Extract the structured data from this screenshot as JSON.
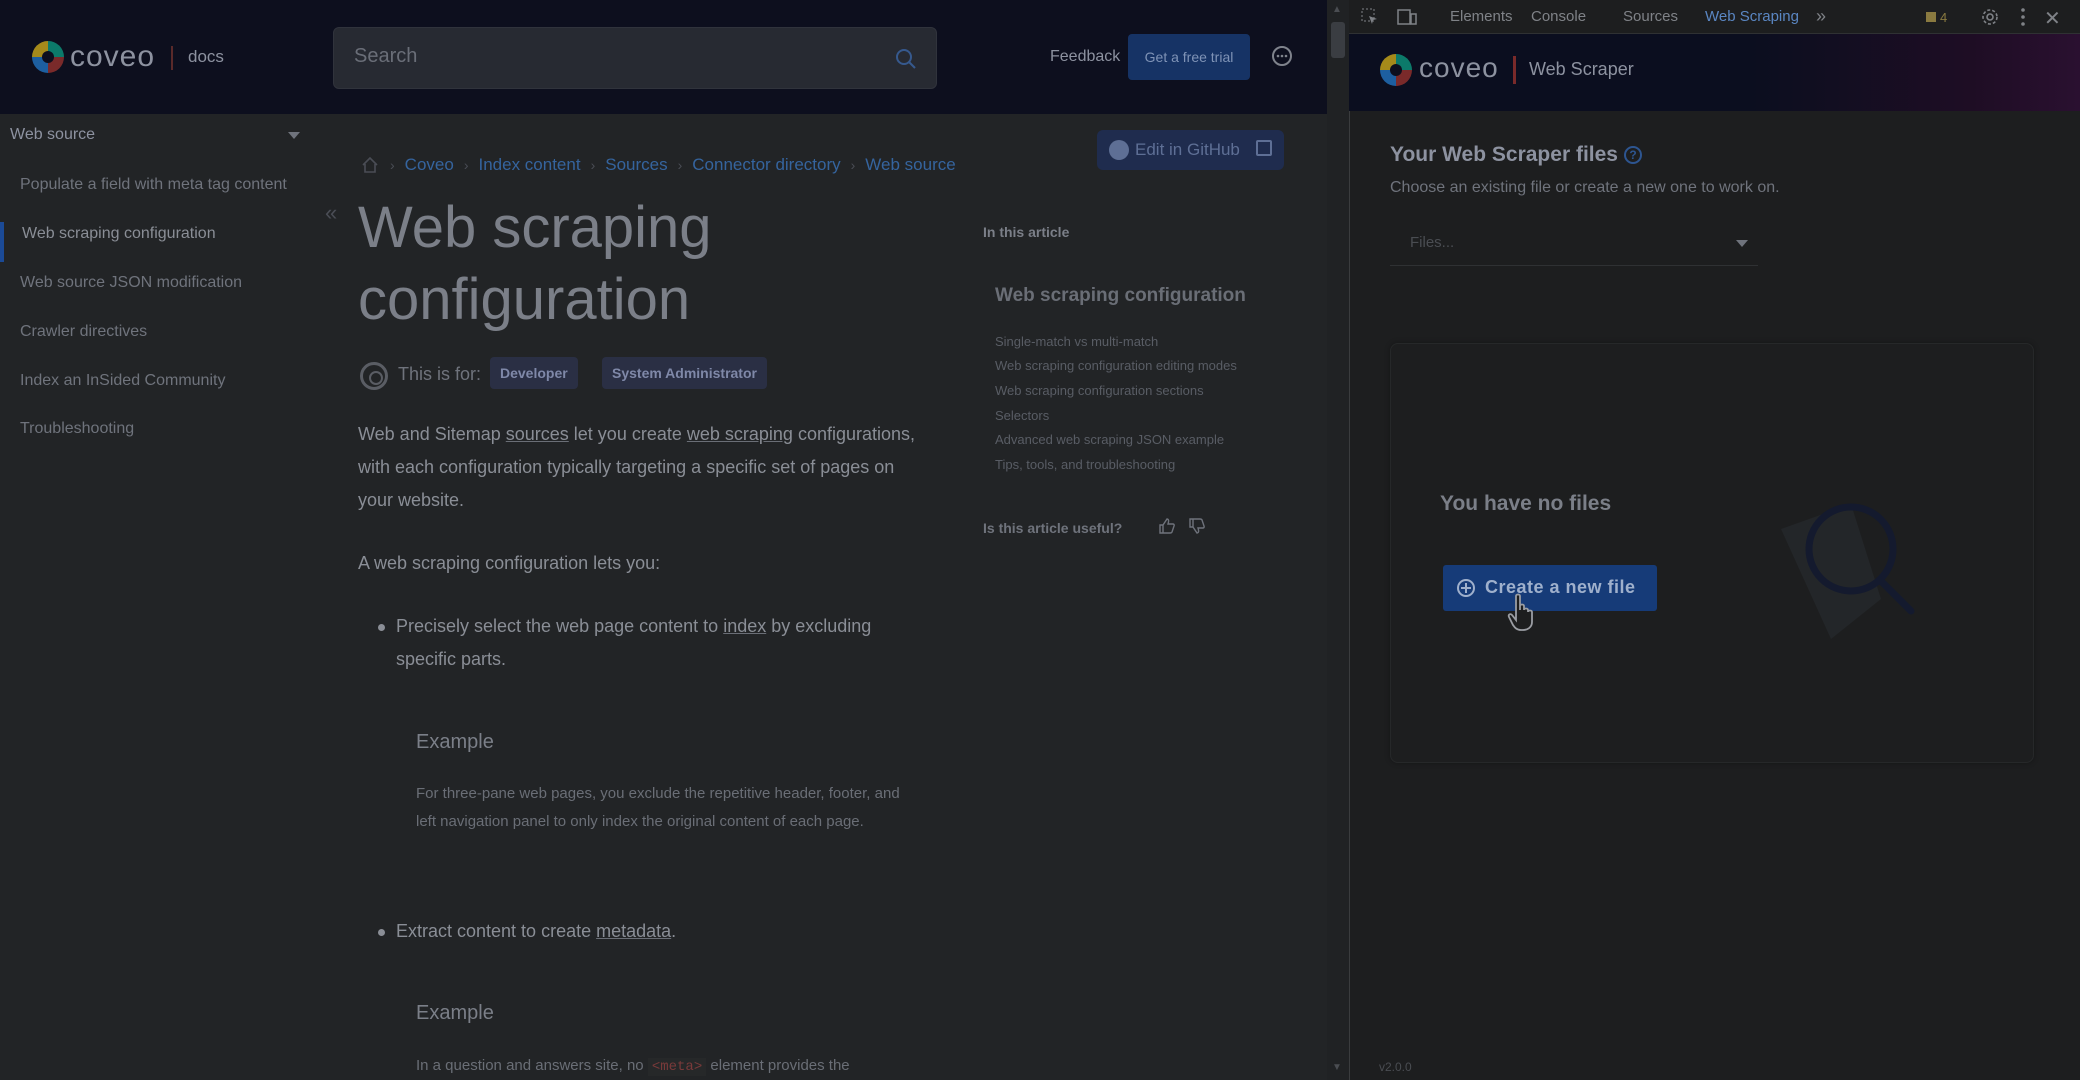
{
  "docs": {
    "logo_text": "coveo",
    "logo_sub": "docs",
    "search_placeholder": "Search",
    "feedback": "Feedback",
    "trial": "Get a free trial",
    "nav": {
      "section": "Web source",
      "items": [
        "Populate a field with meta tag content",
        "Web scraping configuration",
        "Web source JSON modification",
        "Crawler directives",
        "Index an InSided Community",
        "Troubleshooting"
      ]
    },
    "breadcrumb": [
      "Coveo",
      "Index content",
      "Sources",
      "Connector directory",
      "Web source"
    ],
    "github_label": "Edit in GitHub",
    "title": "Web scraping configuration",
    "audience_label": "This is for:",
    "audience_tags": [
      "Developer",
      "System Administrator"
    ],
    "intro": {
      "p1_a": "Web and Sitemap ",
      "p1_link1": "sources",
      "p1_b": " let you create ",
      "p1_link2": "web scraping",
      "p1_c": " configurations, with each configuration typically targeting a specific set of pages on your website.",
      "p2": "A web scraping configuration lets you:"
    },
    "bullets": [
      {
        "a": "Precisely select the web page content to ",
        "link": "index",
        "b": " by excluding specific parts.",
        "example_title": "Example",
        "example_text": "For three-pane web pages, you exclude the repetitive header, footer, and left navigation panel to only index the original content of each page."
      },
      {
        "a": "Extract content to create ",
        "link": "metadata",
        "b": ".",
        "example_title": "Example",
        "example_text_a": "In a question and answers site, no ",
        "example_code": "<meta>",
        "example_text_b": " element provides the"
      }
    ],
    "toc": {
      "heading": "In this article",
      "title": "Web scraping configuration",
      "items": [
        "Single-match vs multi-match",
        "Web scraping configuration editing modes",
        "Web scraping configuration sections",
        "Selectors",
        "Advanced web scraping JSON example",
        "Tips, tools, and troubleshooting"
      ],
      "useful": "Is this article useful?"
    }
  },
  "devtools": {
    "tabs": [
      "Elements",
      "Console",
      "Sources",
      "Web Scraping"
    ],
    "active_tab": "Web Scraping",
    "warnings": "4",
    "header_logo": "coveo",
    "header_title": "Web Scraper",
    "files_heading": "Your Web Scraper files",
    "files_sub": "Choose an existing file or create a new one to work on.",
    "files_placeholder": "Files...",
    "empty_title": "You have no files",
    "create_label": "Create a new file",
    "version": "v2.0.0"
  }
}
